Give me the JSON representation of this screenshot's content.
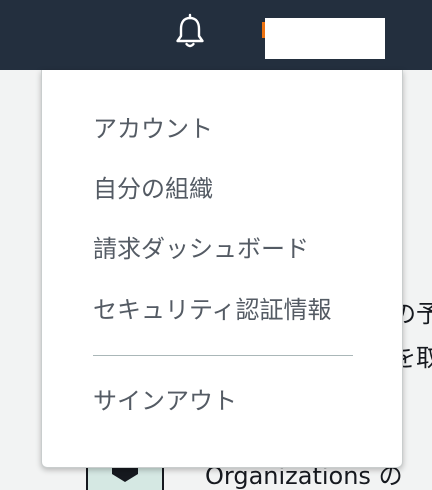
{
  "header": {
    "notification_icon": "bell-icon",
    "colors": {
      "background": "#232f3e",
      "accent": "#ec7211"
    }
  },
  "account_menu": {
    "items": [
      {
        "label": "アカウント"
      },
      {
        "label": "自分の組織"
      },
      {
        "label": "請求ダッシュボード"
      },
      {
        "label": "セキュリティ認証情報"
      }
    ],
    "sign_out": {
      "label": "サインアウト"
    }
  },
  "background": {
    "text_fragment_1": "の予",
    "text_fragment_2": "を取",
    "text_fragment_3": "Organizations の"
  }
}
